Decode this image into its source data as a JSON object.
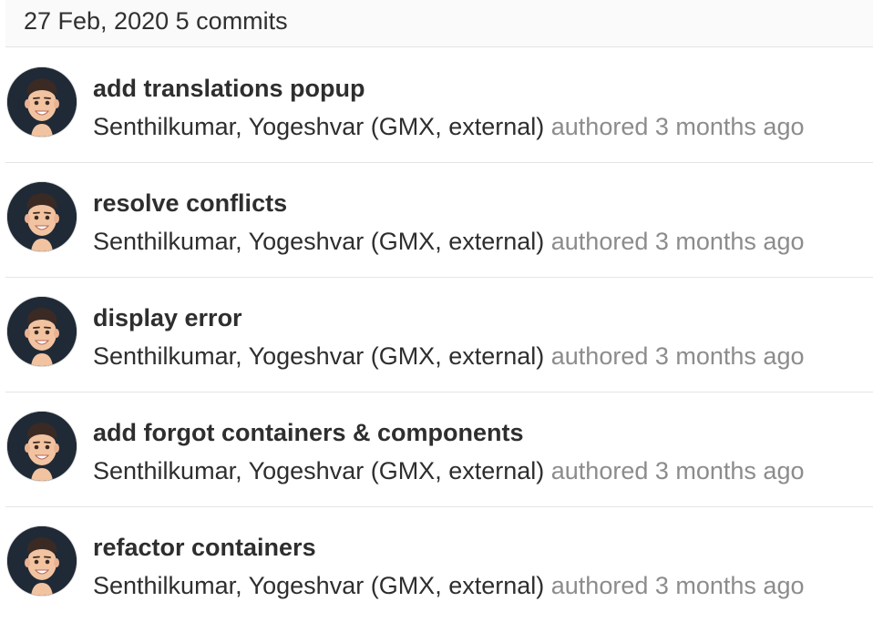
{
  "group": {
    "date": "27 Feb, 2020",
    "count_label": "5 commits"
  },
  "commits": [
    {
      "title": "add translations popup",
      "author": "Senthilkumar, Yogeshvar (GMX, external)",
      "authored_label": "authored",
      "time": "3 months ago",
      "avatar_icon": "memoji-avatar-icon"
    },
    {
      "title": "resolve conflicts",
      "author": "Senthilkumar, Yogeshvar (GMX, external)",
      "authored_label": "authored",
      "time": "3 months ago",
      "avatar_icon": "memoji-avatar-icon"
    },
    {
      "title": "display error",
      "author": "Senthilkumar, Yogeshvar (GMX, external)",
      "authored_label": "authored",
      "time": "3 months ago",
      "avatar_icon": "memoji-avatar-icon"
    },
    {
      "title": "add forgot containers & components",
      "author": "Senthilkumar, Yogeshvar (GMX, external)",
      "authored_label": "authored",
      "time": "3 months ago",
      "avatar_icon": "memoji-avatar-icon"
    },
    {
      "title": "refactor containers",
      "author": "Senthilkumar, Yogeshvar (GMX, external)",
      "authored_label": "authored",
      "time": "3 months ago",
      "avatar_icon": "memoji-avatar-icon"
    }
  ],
  "colors": {
    "avatar_bg": "#1f2a36",
    "muted_text": "#8c8c8c",
    "header_bg": "#fafafa"
  }
}
